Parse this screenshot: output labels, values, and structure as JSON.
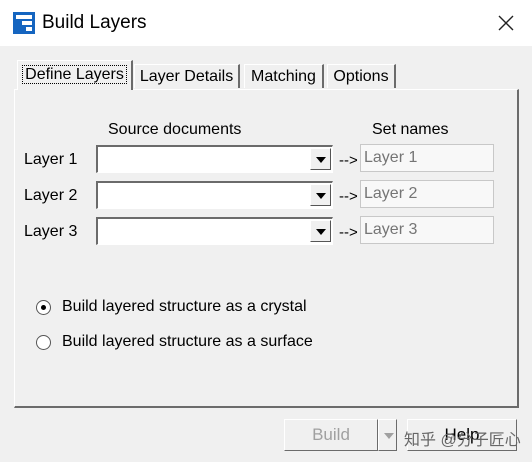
{
  "window": {
    "title": "Build Layers",
    "accent": "#1565c0"
  },
  "tabs": [
    {
      "label": "Define Layers",
      "active": true
    },
    {
      "label": "Layer Details",
      "active": false
    },
    {
      "label": "Matching",
      "active": false
    },
    {
      "label": "Options",
      "active": false
    }
  ],
  "headers": {
    "source": "Source documents",
    "names": "Set names"
  },
  "layers": [
    {
      "label": "Layer 1",
      "source": "",
      "arrow": "-->",
      "name_placeholder": "Layer 1"
    },
    {
      "label": "Layer 2",
      "source": "",
      "arrow": "-->",
      "name_placeholder": "Layer 2"
    },
    {
      "label": "Layer 3",
      "source": "",
      "arrow": "-->",
      "name_placeholder": "Layer 3"
    }
  ],
  "structure_options": [
    {
      "label": "Build layered structure as a crystal",
      "selected": true
    },
    {
      "label": "Build layered structure as a surface",
      "selected": false
    }
  ],
  "buttons": {
    "build": "Build",
    "help": "Help"
  },
  "watermark": "知乎 @分子匠心"
}
